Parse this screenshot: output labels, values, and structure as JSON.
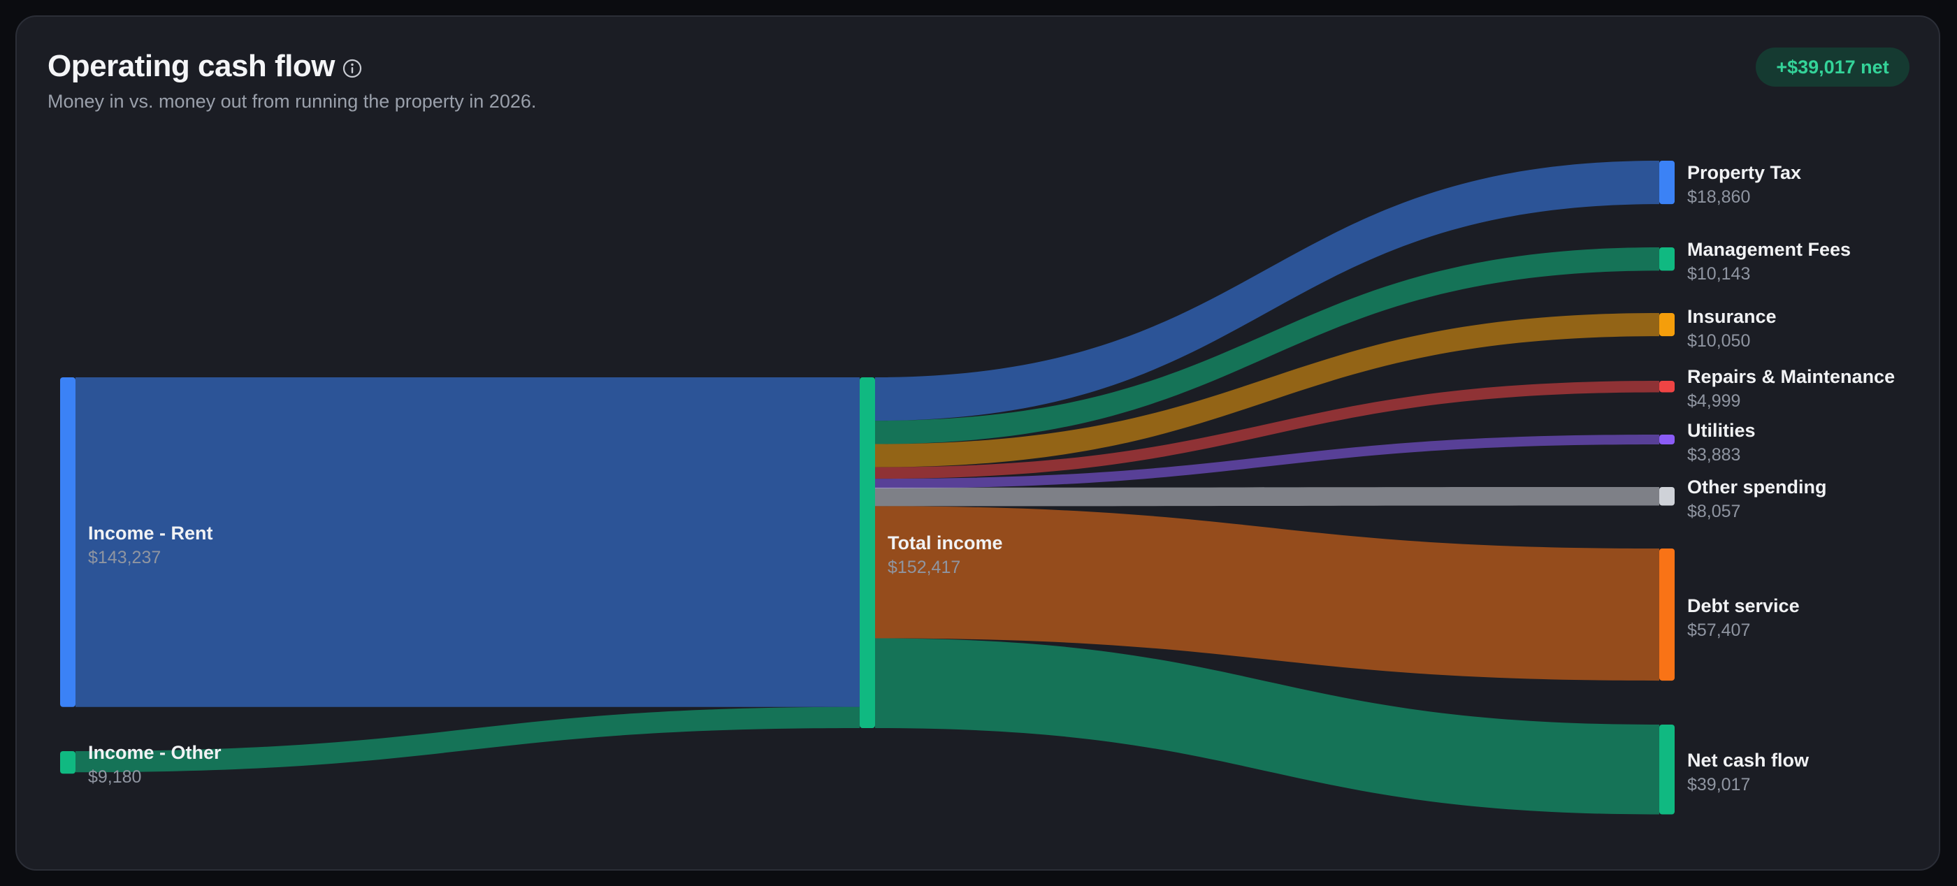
{
  "header": {
    "title": "Operating cash flow",
    "subtitle": "Money in vs. money out from running the property in 2026.",
    "badge": "+$39,017 net"
  },
  "colors": {
    "blue": "#3b82f6",
    "green": "#10b981",
    "amber": "#f59e0b",
    "red": "#ef4444",
    "purple": "#8b5cf6",
    "gray": "#cfd2d8",
    "orange": "#f97316"
  },
  "chart_data": {
    "type": "sankey",
    "title": "Operating cash flow",
    "subtitle": "Money in vs. money out from running the property in 2026.",
    "sources": [
      {
        "id": "rent",
        "name": "Income - Rent",
        "value": 143237,
        "value_label": "$143,237",
        "color": "#3b82f6"
      },
      {
        "id": "other_income",
        "name": "Income - Other",
        "value": 9180,
        "value_label": "$9,180",
        "color": "#10b981"
      }
    ],
    "hub": {
      "id": "total",
      "name": "Total income",
      "value": 152417,
      "value_label": "$152,417",
      "color": "#10b981"
    },
    "targets": [
      {
        "id": "property_tax",
        "name": "Property Tax",
        "value": 18860,
        "value_label": "$18,860",
        "color": "#3b82f6"
      },
      {
        "id": "management_fees",
        "name": "Management Fees",
        "value": 10143,
        "value_label": "$10,143",
        "color": "#10b981"
      },
      {
        "id": "insurance",
        "name": "Insurance",
        "value": 10050,
        "value_label": "$10,050",
        "color": "#f59e0b"
      },
      {
        "id": "repairs",
        "name": "Repairs & Maintenance",
        "value": 4999,
        "value_label": "$4,999",
        "color": "#ef4444"
      },
      {
        "id": "utilities",
        "name": "Utilities",
        "value": 3883,
        "value_label": "$3,883",
        "color": "#8b5cf6"
      },
      {
        "id": "other_spending",
        "name": "Other spending",
        "value": 8057,
        "value_label": "$8,057",
        "color": "#cfd2d8"
      },
      {
        "id": "debt_service",
        "name": "Debt service",
        "value": 57407,
        "value_label": "$57,407",
        "color": "#f97316"
      },
      {
        "id": "net_cash_flow",
        "name": "Net cash flow",
        "value": 39017,
        "value_label": "$39,017",
        "color": "#10b981"
      }
    ]
  }
}
